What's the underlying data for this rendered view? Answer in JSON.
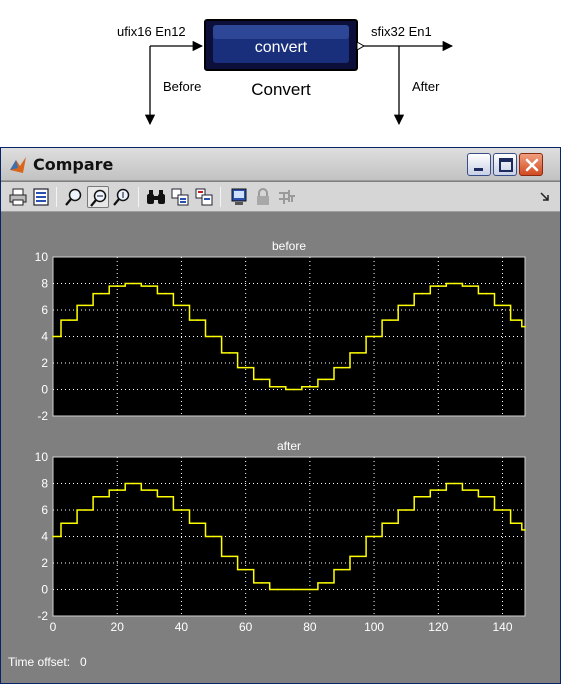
{
  "diagram": {
    "input_type": "ufix16 En12",
    "output_type": "sfix32 En1",
    "block_label": "convert",
    "block_name": "Convert",
    "before_label": "Before",
    "after_label": "After"
  },
  "window": {
    "title": "Compare",
    "icons": {
      "app": "matlab-icon",
      "minimize": "minimize-icon",
      "maximize": "maximize-icon",
      "close": "close-icon"
    }
  },
  "toolbar": {
    "items": [
      "print-icon",
      "parameters-icon",
      "zoom-icon",
      "zoom-x-icon",
      "zoom-y-icon",
      "autoscale-icon",
      "save-axes-icon",
      "restore-axes-icon",
      "floating-scope-icon",
      "lock-icon",
      "signal-selector-icon",
      "toolbar-more-icon"
    ]
  },
  "status": {
    "time_offset_label": "Time offset:",
    "time_offset_value": "0"
  },
  "colors": {
    "plot_background": "#000000",
    "figure_background": "#7f7f7f",
    "signal": "#ffff00",
    "grid": "#ffffff"
  },
  "chart_data": [
    {
      "type": "line",
      "title": "before",
      "xlim": [
        0,
        147
      ],
      "ylim": [
        -2,
        10
      ],
      "yticks": [
        -2,
        0,
        2,
        4,
        6,
        8,
        10
      ],
      "xticks": [],
      "grid": true,
      "series": [
        {
          "description": "sine wave, offset 4, amplitude 4, period 100",
          "x": [
            0,
            5,
            10,
            15,
            20,
            25,
            30,
            35,
            40,
            45,
            50,
            55,
            60,
            65,
            70,
            75,
            80,
            85,
            90,
            95,
            100,
            105,
            110,
            115,
            120,
            125,
            130,
            135,
            140,
            145,
            147
          ],
          "values": [
            4.0,
            5.24,
            6.35,
            7.24,
            7.8,
            8.0,
            7.8,
            7.24,
            6.35,
            5.24,
            4.0,
            2.76,
            1.65,
            0.76,
            0.2,
            0.0,
            0.2,
            0.76,
            1.65,
            2.76,
            4.0,
            5.24,
            6.35,
            7.24,
            7.8,
            8.0,
            7.8,
            7.24,
            6.35,
            5.24,
            4.75
          ]
        }
      ]
    },
    {
      "type": "line",
      "title": "after",
      "xlim": [
        0,
        147
      ],
      "ylim": [
        -2,
        10
      ],
      "yticks": [
        -2,
        0,
        2,
        4,
        6,
        8,
        10
      ],
      "xticks": [
        0,
        20,
        40,
        60,
        80,
        100,
        120,
        140
      ],
      "grid": true,
      "series": [
        {
          "description": "same sine wave quantized to step 0.5, negative outputs clipped to 0 at 0.5-sample granularity",
          "x": [
            0,
            5,
            10,
            15,
            20,
            25,
            30,
            35,
            40,
            45,
            50,
            55,
            60,
            65,
            70,
            75,
            80,
            85,
            90,
            95,
            100,
            105,
            110,
            115,
            120,
            125,
            130,
            135,
            140,
            145,
            147
          ],
          "values": [
            4.0,
            5.0,
            6.0,
            7.0,
            7.5,
            8.0,
            7.5,
            7.0,
            6.0,
            5.0,
            4.0,
            2.5,
            1.5,
            0.5,
            0.0,
            0.0,
            0.0,
            0.5,
            1.5,
            2.5,
            4.0,
            5.0,
            6.0,
            7.0,
            7.5,
            8.0,
            7.5,
            7.0,
            6.0,
            5.0,
            4.5
          ]
        }
      ]
    }
  ]
}
